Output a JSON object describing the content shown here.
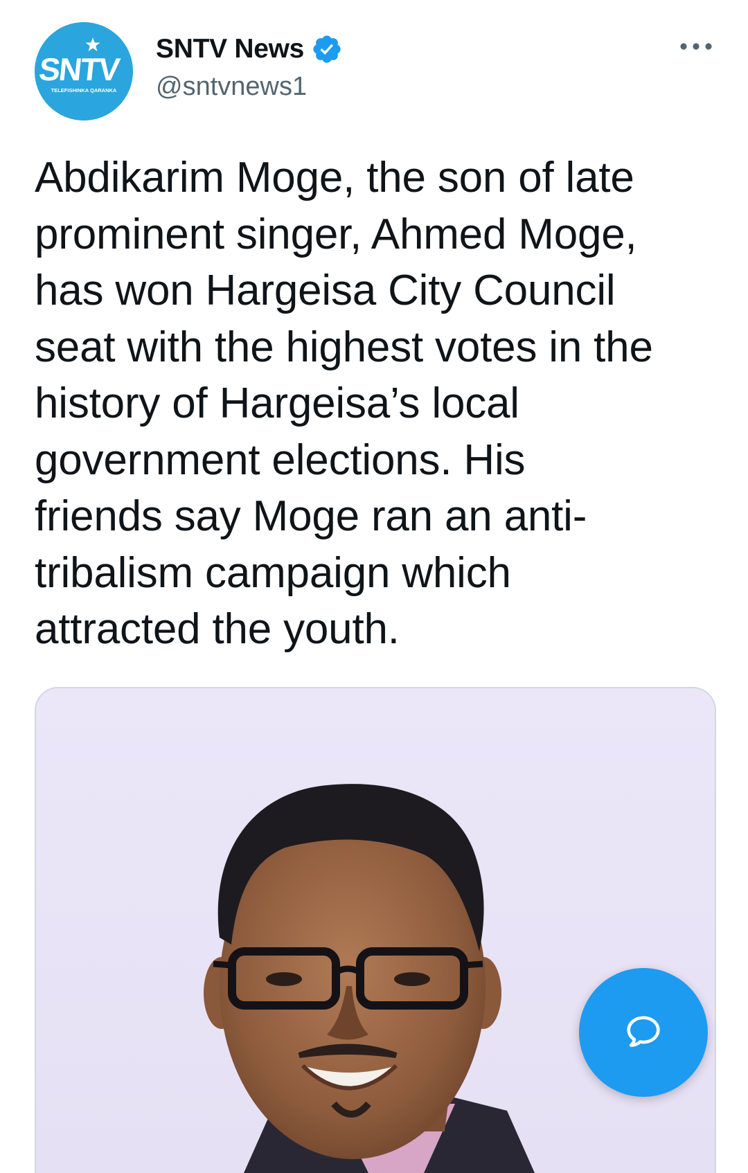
{
  "account": {
    "display_name": "SNTV News",
    "handle": "@sntvnews1",
    "avatar_text": "SNTV",
    "avatar_subtext": "TELEFISHINKA QARANKA",
    "verified_icon": "verified-badge-icon"
  },
  "tweet": {
    "text": "Abdikarim Moge, the son of late\nprominent singer, Ahmed Moge,\nhas won Hargeisa City Council\nseat with the highest votes in the\nhistory of Hargeisa’s local\ngovernment elections. His\nfriends say Moge  ran an anti-\ntribalism campaign which\nattracted the youth."
  },
  "icons": {
    "more": "more-options-icon",
    "compose": "reply-bubble-icon"
  },
  "colors": {
    "brand_blue": "#1d9bf0",
    "avatar_blue": "#2aa5de",
    "text_primary": "#0f1419",
    "text_secondary": "#536471",
    "photo_background": "#ebe6f7"
  }
}
